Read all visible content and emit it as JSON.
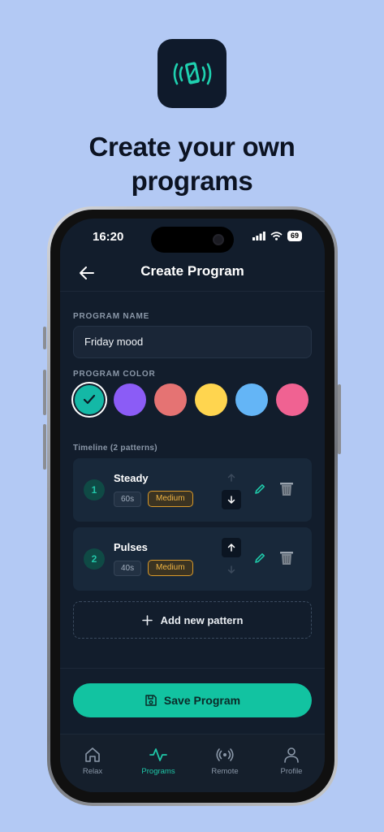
{
  "promo": {
    "headline_line1": "Create your own",
    "headline_line2": "programs",
    "app_icon": "vibrating-phone-icon"
  },
  "status_bar": {
    "time": "16:20",
    "battery": "69"
  },
  "header": {
    "title": "Create Program",
    "back_icon": "arrow-left-icon"
  },
  "form": {
    "program_name_label": "PROGRAM NAME",
    "program_name_value": "Friday mood",
    "program_color_label": "PROGRAM COLOR",
    "colors": [
      "#14b8a6",
      "#8b5cf6",
      "#e57373",
      "#ffd54f",
      "#64b5f6",
      "#f06292"
    ],
    "selected_color_index": 0
  },
  "timeline": {
    "label": "Timeline (2 patterns)",
    "patterns": [
      {
        "number": "1",
        "name": "Steady",
        "duration": "60s",
        "intensity": "Medium",
        "up_enabled": false,
        "down_enabled": true
      },
      {
        "number": "2",
        "name": "Pulses",
        "duration": "40s",
        "intensity": "Medium",
        "up_enabled": true,
        "down_enabled": false
      }
    ],
    "add_label": "Add new pattern"
  },
  "save_label": "Save Program",
  "tabs": [
    {
      "label": "Relax",
      "icon": "home-icon",
      "active": false
    },
    {
      "label": "Programs",
      "icon": "activity-icon",
      "active": true
    },
    {
      "label": "Remote",
      "icon": "broadcast-icon",
      "active": false
    },
    {
      "label": "Profile",
      "icon": "user-icon",
      "active": false
    }
  ],
  "accent_color": "#12c3a1",
  "intensity_color": "#f0b544"
}
